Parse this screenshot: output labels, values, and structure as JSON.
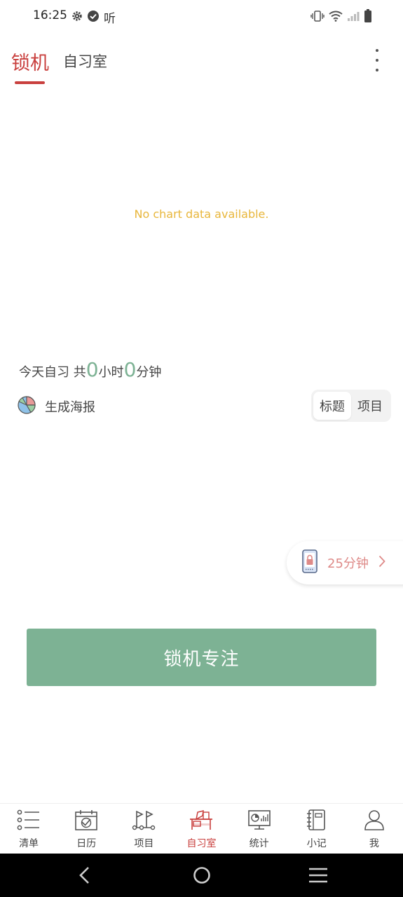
{
  "status_bar": {
    "time": "16:25",
    "listen_label": "听"
  },
  "top_tabs": {
    "lock_tab": "锁机",
    "study_tab": "自习室"
  },
  "chart": {
    "empty_message": "No chart data available."
  },
  "today": {
    "prefix": "今天自习 共",
    "hours": "0",
    "hours_unit": "小时",
    "minutes": "0",
    "minutes_unit": "分钟"
  },
  "poster": {
    "label": "生成海报"
  },
  "segment": {
    "options": [
      "标题",
      "项目"
    ],
    "selected": "标题"
  },
  "timer": {
    "label": "25分钟"
  },
  "focus_button": {
    "label": "锁机专注"
  },
  "bottom_nav": {
    "items": [
      {
        "label": "清单",
        "icon": "list-icon"
      },
      {
        "label": "日历",
        "icon": "calendar-icon"
      },
      {
        "label": "项目",
        "icon": "project-icon"
      },
      {
        "label": "自习室",
        "icon": "study-room-icon"
      },
      {
        "label": "统计",
        "icon": "stats-icon"
      },
      {
        "label": "小记",
        "icon": "notebook-icon"
      },
      {
        "label": "我",
        "icon": "profile-icon"
      }
    ],
    "active": "自习室"
  },
  "colors": {
    "accent_red": "#c9403e",
    "focus_green": "#7db294",
    "empty_text_yellow": "#e8b63a",
    "timer_pink": "#de8a88"
  }
}
